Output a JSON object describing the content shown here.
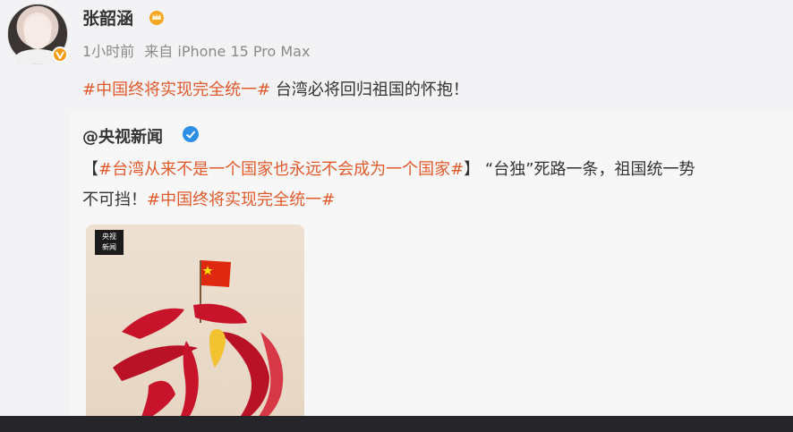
{
  "post": {
    "username": "张韶涵",
    "time": "1小时前",
    "source": "来自 iPhone 15 Pro Max",
    "topic": "#中国终将实现完全统一#",
    "text": " 台湾必将回归祖国的怀抱！"
  },
  "repost": {
    "author": "@央视新闻",
    "line1_open": "【",
    "line1_topic": "#台湾从来不是一个国家也永远不会成为一个国家#",
    "line1_rest": "】 “台独”死路一条，祖国统一势",
    "line2_rest": "不可挡！",
    "line2_topic": "#中国终将实现完全统一#"
  },
  "media": {
    "logo_text_top": "央视",
    "logo_text_bottom": "新闻"
  },
  "colors": {
    "topic": "#e05a2b",
    "verified_orange": "#f39c12",
    "verified_blue": "#2d8ee6",
    "flag_red": "#de2910",
    "stroke_red": "#c8142b",
    "taiwan_yellow": "#f2c230"
  },
  "icons": [
    "verified-badge-icon",
    "vip-crown-icon",
    "verified-blue-icon",
    "cctv-logo",
    "china-flag-icon"
  ]
}
